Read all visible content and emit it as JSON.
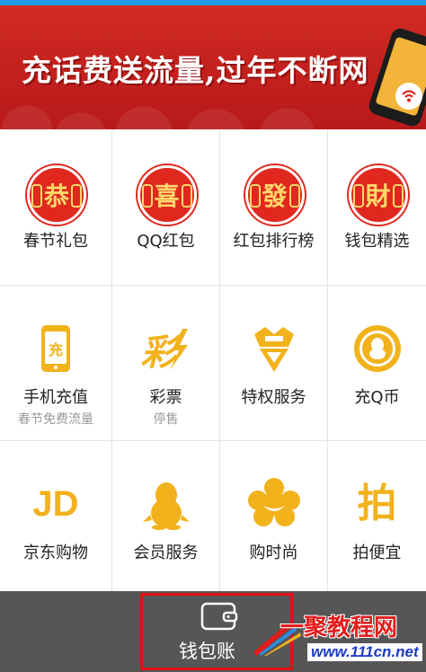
{
  "banner": {
    "text": "充话费送流量,过年不断网",
    "icon": "wifi-icon"
  },
  "grid": {
    "items": [
      {
        "label": "春节礼包",
        "sub": "",
        "icon": "gong-seal-icon",
        "seal_char": "恭"
      },
      {
        "label": "QQ红包",
        "sub": "",
        "icon": "xi-seal-icon",
        "seal_char": "喜"
      },
      {
        "label": "红包排行榜",
        "sub": "",
        "icon": "fa-seal-icon",
        "seal_char": "發"
      },
      {
        "label": "钱包精选",
        "sub": "",
        "icon": "cai-seal-icon",
        "seal_char": "財"
      },
      {
        "label": "手机充值",
        "sub": "春节免费流量",
        "icon": "phone-recharge-icon",
        "icon_char": "充"
      },
      {
        "label": "彩票",
        "sub": "停售",
        "icon": "lottery-icon",
        "icon_char": "彩"
      },
      {
        "label": "特权服务",
        "sub": "",
        "icon": "crown-icon"
      },
      {
        "label": "充Q币",
        "sub": "",
        "icon": "qq-coin-icon"
      },
      {
        "label": "京东购物",
        "sub": "",
        "icon": "jd-icon",
        "icon_char": "JD"
      },
      {
        "label": "会员服务",
        "sub": "",
        "icon": "penguin-icon"
      },
      {
        "label": "购时尚",
        "sub": "",
        "icon": "fashion-icon"
      },
      {
        "label": "拍便宜",
        "sub": "",
        "icon": "pai-icon",
        "icon_char": "拍"
      }
    ]
  },
  "bottom_bar": {
    "wallet_label": "钱包账",
    "wallet_icon": "wallet-icon"
  },
  "watermark": {
    "line1": "一聚教程网",
    "line2": "www.111cn.net"
  },
  "colors": {
    "topbar": "#1f9be8",
    "banner_red": "#c8201b",
    "seal_red": "#e0281e",
    "icon_orange": "#f2b21c",
    "bottom_bar": "#565656",
    "highlight_border": "#e01111"
  }
}
